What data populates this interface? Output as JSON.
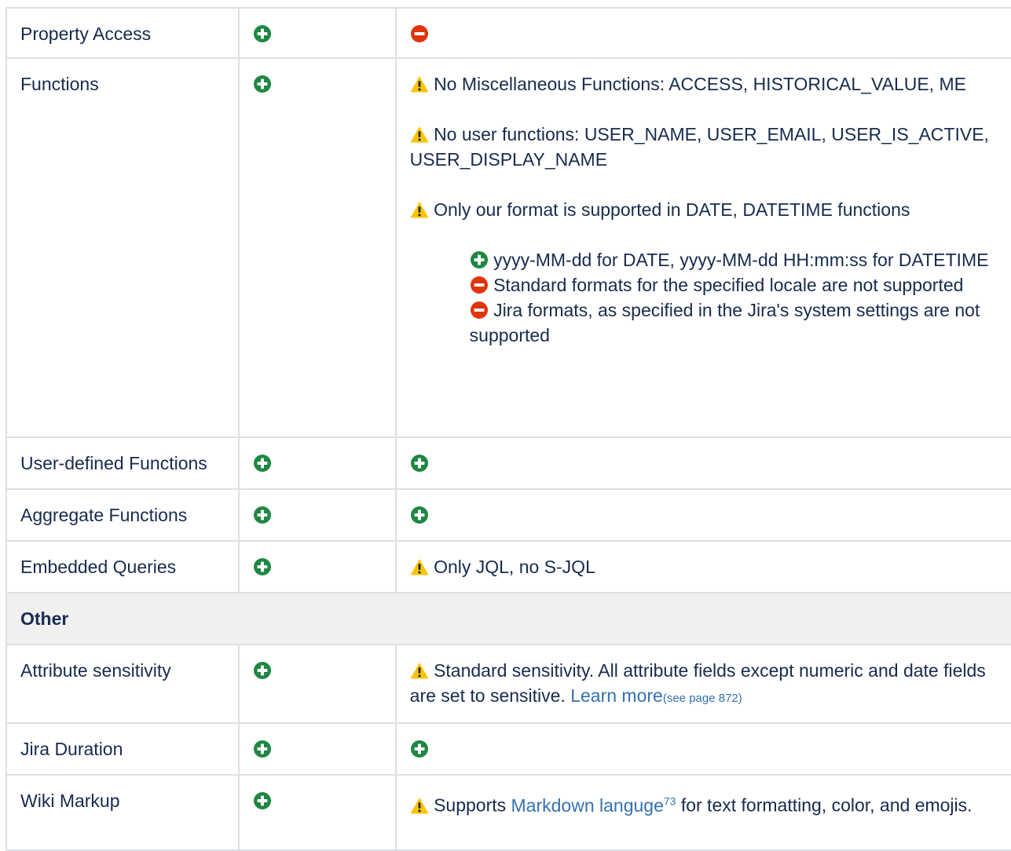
{
  "colors": {
    "plus": "#1e8741",
    "minus": "#de350b",
    "warning": "#ffc400",
    "link": "#3572b0",
    "border": "#dcdfe4",
    "section_bg": "#f0f0f0"
  },
  "icons": {
    "plus": "plus-circle-icon",
    "minus": "minus-circle-icon",
    "warning": "warning-icon"
  },
  "rows": {
    "property_access": {
      "label": "Property Access"
    },
    "functions": {
      "label": "Functions",
      "note1": "No Miscellaneous Functions: ACCESS, HISTORICAL_VALUE, ME",
      "note2": "No user functions: USER_NAME, USER_EMAIL, USER_IS_ACTIVE, USER_DISPLAY_NAME",
      "note3": "Only our format is supported in DATE, DATETIME functions",
      "sub1": "yyyy-MM-dd for DATE, yyyy-MM-dd HH:mm:ss for DATETIME",
      "sub2": "Standard formats for the specified locale are not supported",
      "sub3": "Jira formats, as specified in the Jira's system settings are not supported"
    },
    "user_defined": {
      "label": "User-defined Functions"
    },
    "aggregate": {
      "label": "Aggregate Functions"
    },
    "embedded": {
      "label": "Embedded Queries",
      "note": "Only JQL, no S-JQL"
    },
    "other": {
      "label": "Other"
    },
    "attribute": {
      "label": "Attribute sensitivity",
      "note": "Standard sensitivity. All attribute fields except numeric and date fields are set to sensitive.",
      "link": "Learn more",
      "link_ref": "(see page 872)"
    },
    "duration": {
      "label": "Jira Duration"
    },
    "wiki": {
      "label": "Wiki Markup",
      "note_before": "Supports",
      "link": "Markdown languge",
      "footnote": "73",
      "note_after": "for text formatting, color, and emojis."
    }
  }
}
